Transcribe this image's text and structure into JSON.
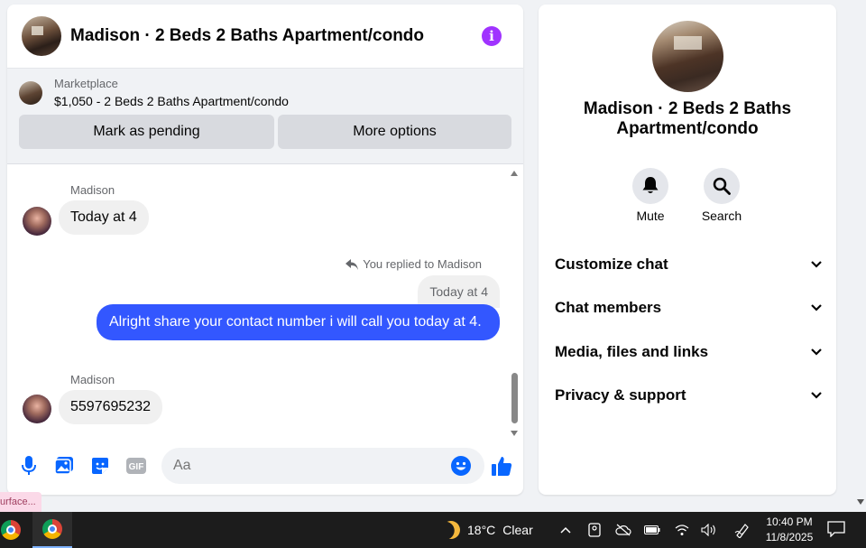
{
  "chat": {
    "title": "Madison · 2 Beds 2 Baths Apartment/condo",
    "info_icon": "i"
  },
  "marketplace": {
    "label": "Marketplace",
    "listing": "$1,050 - 2 Beds 2 Baths Apartment/condo",
    "mark_pending": "Mark as pending",
    "more_options": "More options"
  },
  "messages": {
    "sender1": "Madison",
    "msg1": "Today at 4",
    "reply_note": "You replied to Madison",
    "reply_quote": "Today at 4",
    "outgoing": "Alright share your contact number i will call you today at 4.",
    "sender2": "Madison",
    "msg2": "5597695232"
  },
  "composer": {
    "placeholder": "Aa",
    "gif_label": "GIF"
  },
  "side": {
    "title": "Madison · 2 Beds 2 Baths Apartment/condo",
    "mute": "Mute",
    "search": "Search",
    "sections": [
      "Customize chat",
      "Chat members",
      "Media, files and links",
      "Privacy & support"
    ]
  },
  "tooltip": "urface...",
  "taskbar": {
    "temperature": "18°C",
    "condition": "Clear",
    "time": "10:40 PM",
    "date": "11/8/2025"
  },
  "colors": {
    "accent": "#3357ff",
    "info": "#a033ff",
    "icon_blue": "#0866ff"
  }
}
